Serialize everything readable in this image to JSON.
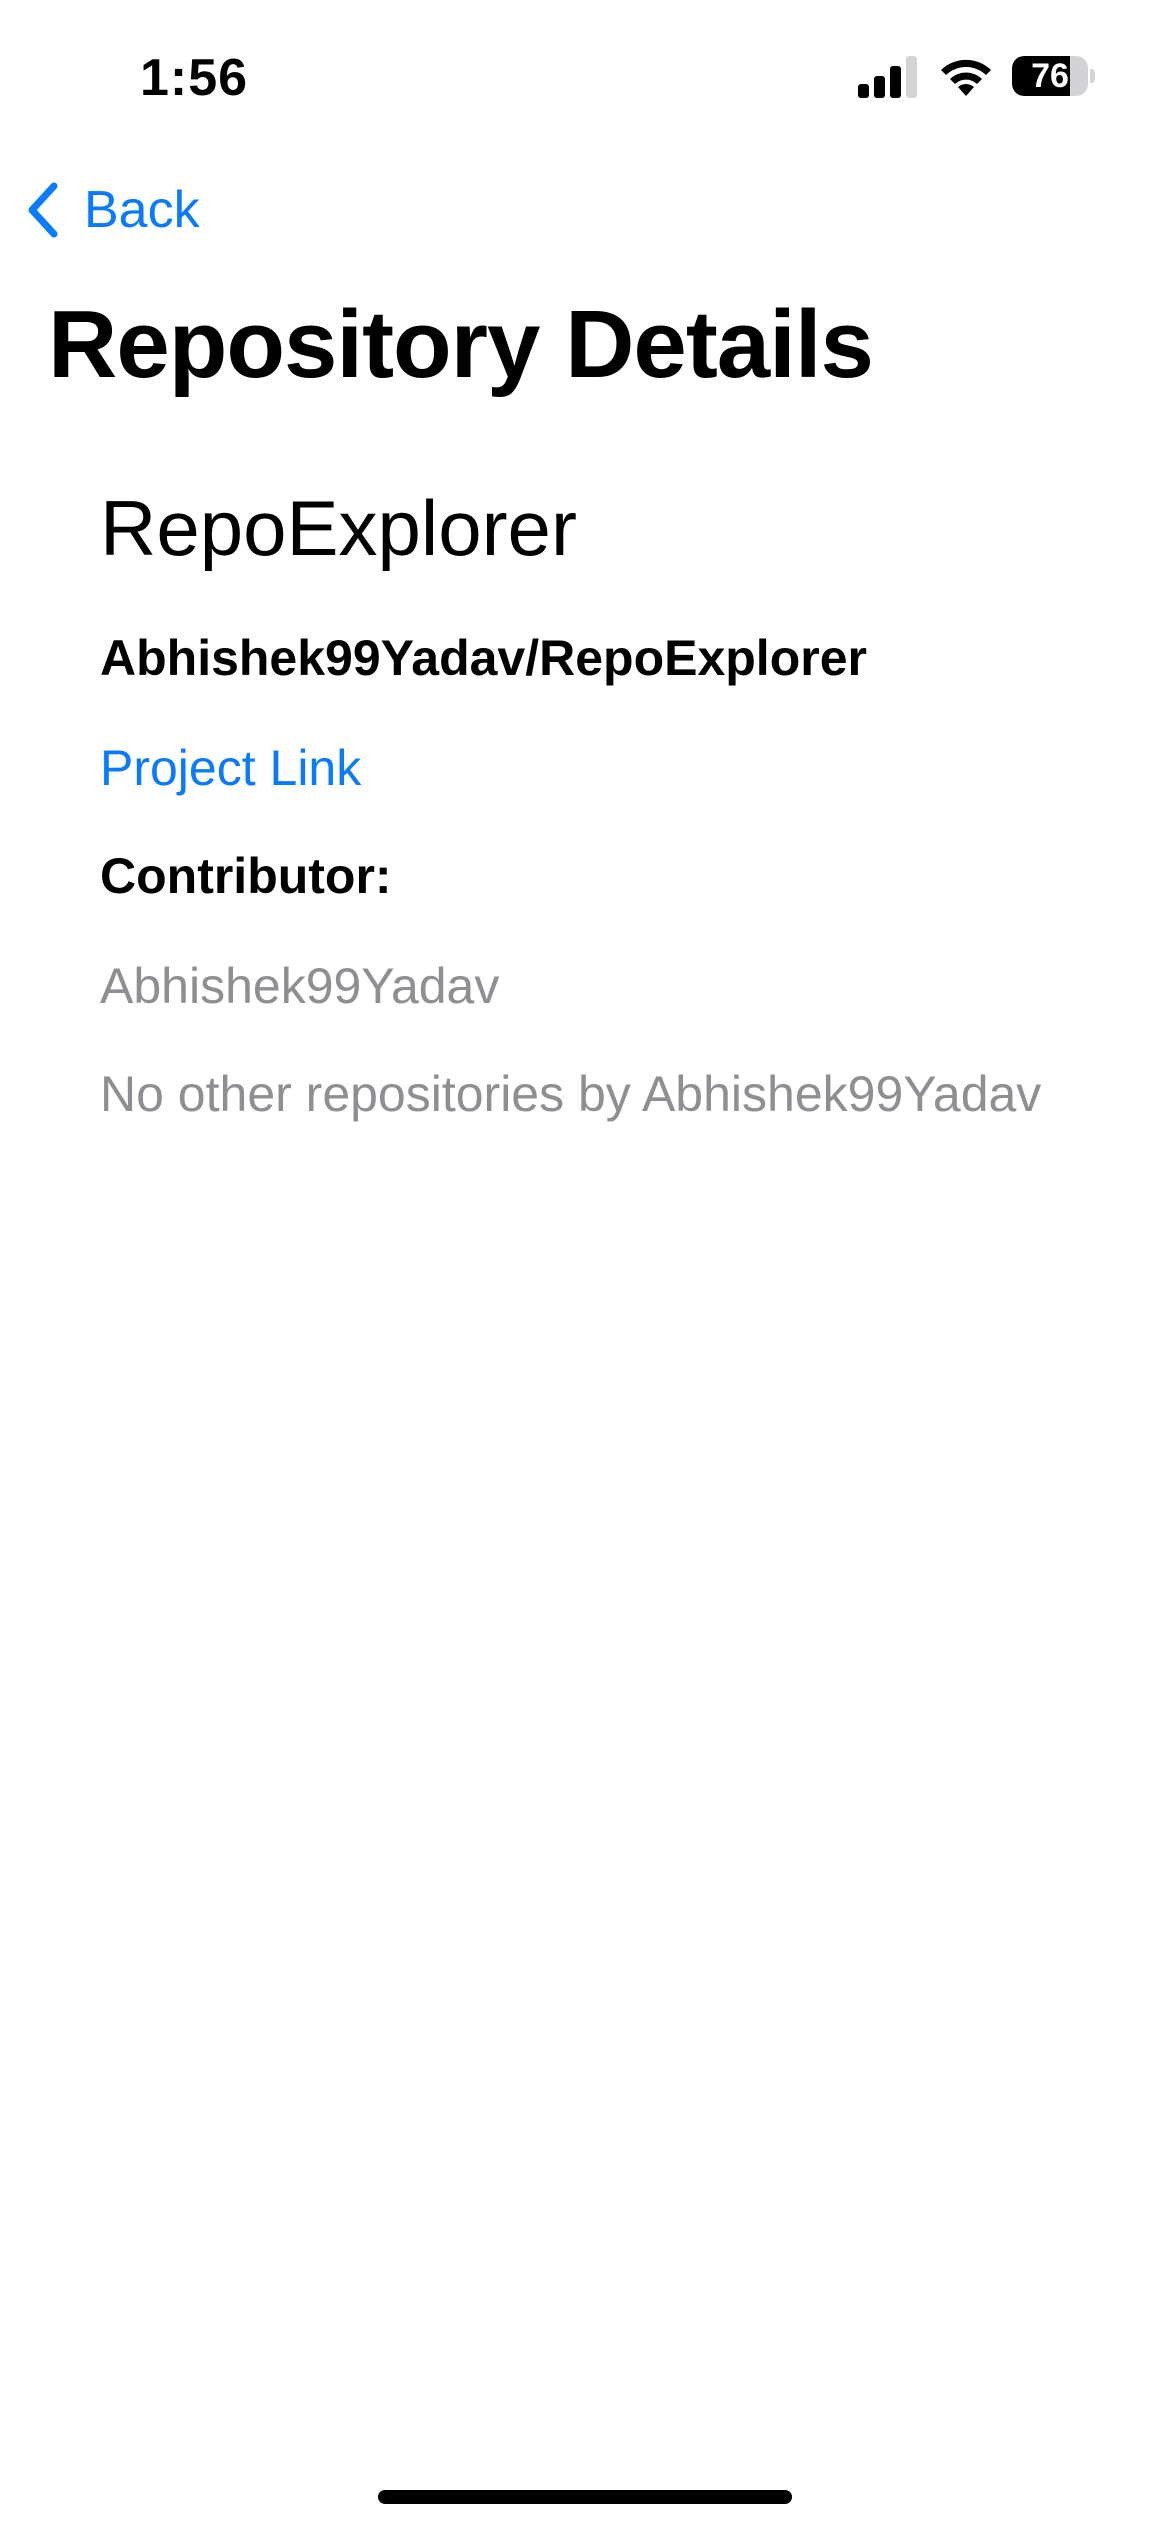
{
  "status_bar": {
    "time": "1:56",
    "battery_level": "76",
    "battery_fraction": 0.76,
    "icons": [
      "signal-icon",
      "wifi-icon",
      "battery-icon"
    ]
  },
  "nav": {
    "back_label": "Back",
    "back_icon": "chevron-left-icon"
  },
  "page": {
    "title": "Repository Details"
  },
  "repository": {
    "name": "RepoExplorer",
    "full_name": "Abhishek99Yadav/RepoExplorer",
    "link_label": "Project Link",
    "contributor_heading": "Contributor:",
    "contributor": "Abhishek99Yadav",
    "other_repos_text": "No other repositories by Abhishek99Yadav"
  },
  "colors": {
    "accent": "#0a7aff",
    "secondary_text": "#8e8e93",
    "primary_text": "#000000",
    "background": "#ffffff"
  }
}
